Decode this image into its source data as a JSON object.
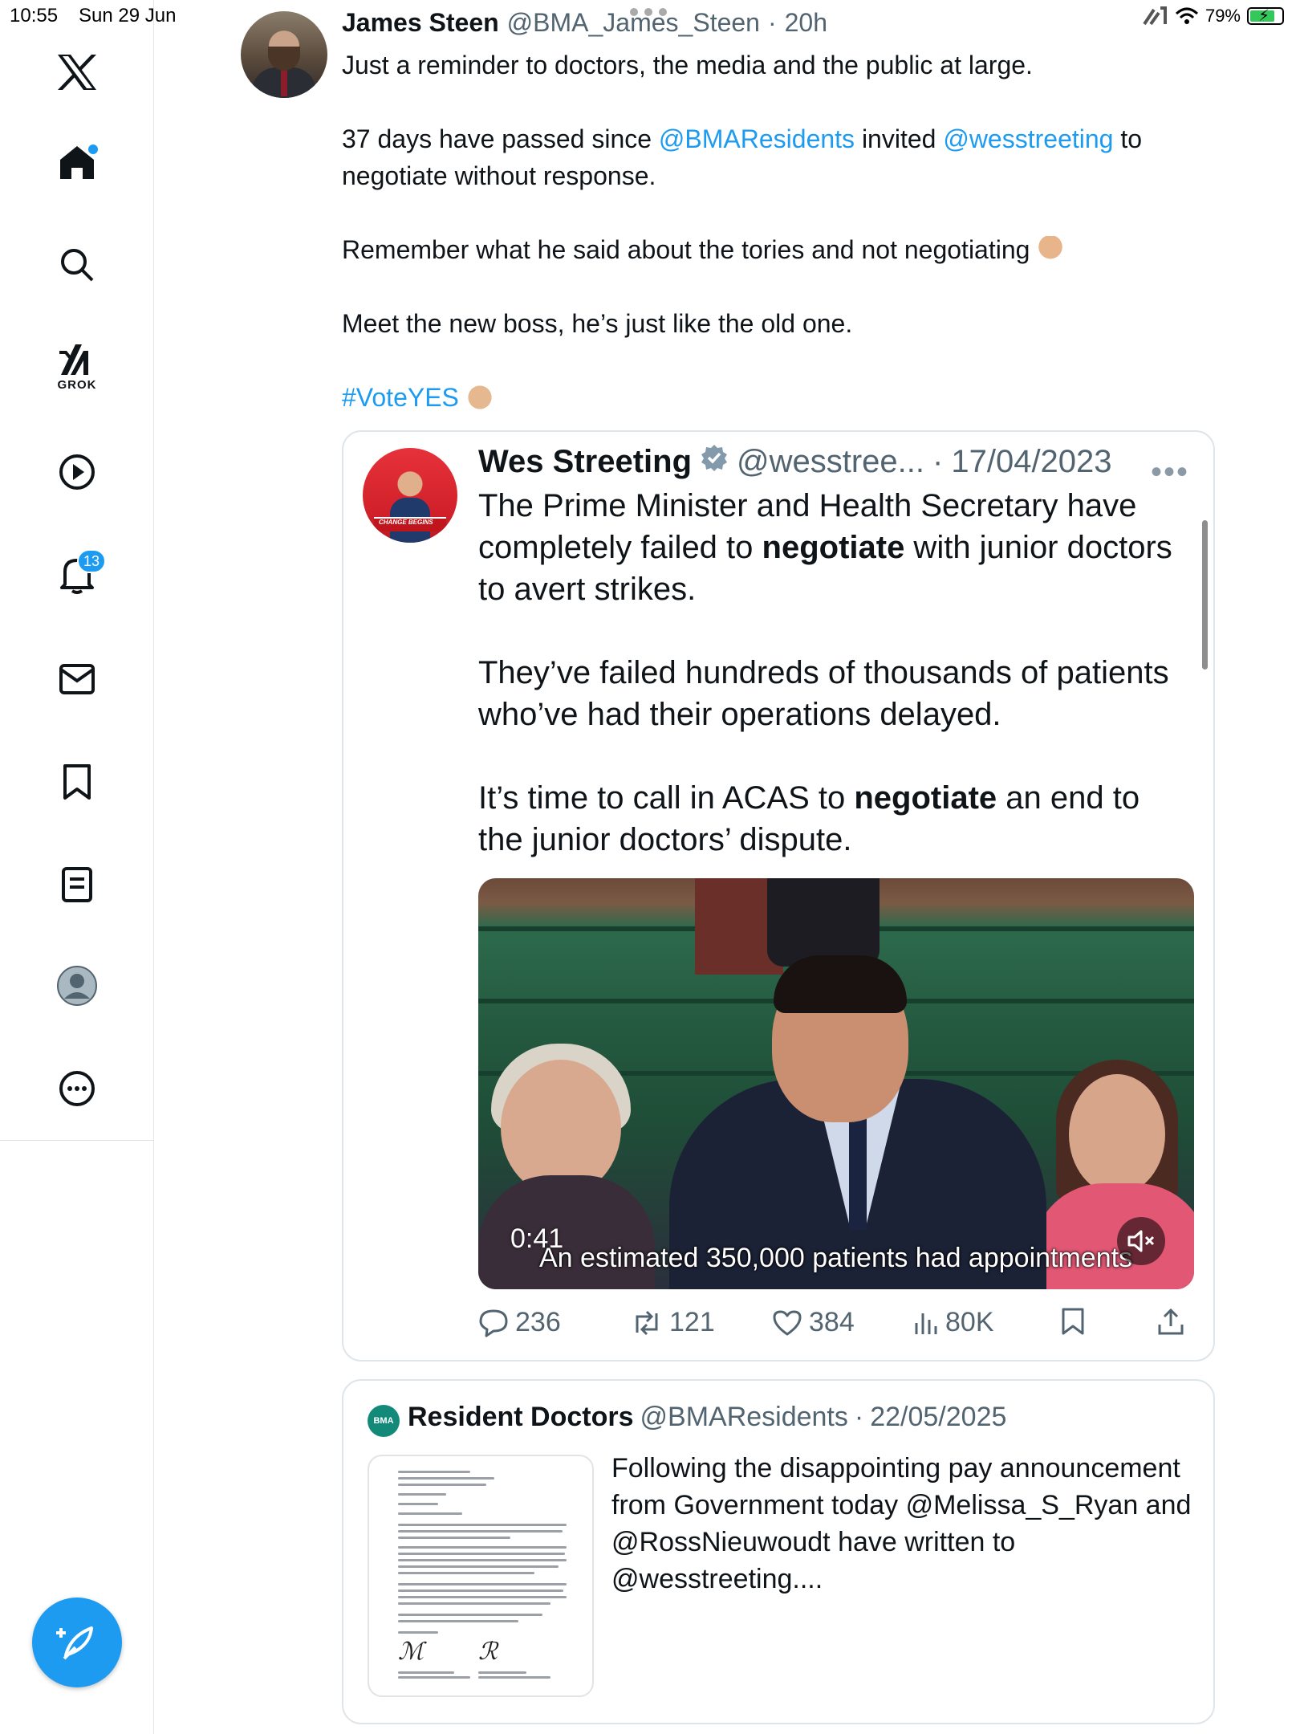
{
  "status_bar": {
    "time": "10:55",
    "date": "Sun 29 Jun",
    "battery": "79%"
  },
  "sidebar": {
    "grok_label": "GROK",
    "notification_count": "13",
    "items": [
      {
        "icon": "x-logo-icon"
      },
      {
        "icon": "home-icon"
      },
      {
        "icon": "search-icon"
      },
      {
        "icon": "grok-icon"
      },
      {
        "icon": "video-play-icon"
      },
      {
        "icon": "notifications-bell-icon"
      },
      {
        "icon": "messages-envelope-icon"
      },
      {
        "icon": "bookmarks-icon"
      },
      {
        "icon": "lists-icon"
      },
      {
        "icon": "profile-icon"
      },
      {
        "icon": "more-icon"
      }
    ]
  },
  "tweet": {
    "author_name": "James Steen",
    "author_handle": "@BMA_James_Steen",
    "time": "20h",
    "line1": "Just a reminder to doctors, the media and the public at large.",
    "line2_pre": "37 days have passed since ",
    "line2_link1": "@BMAResidents",
    "line2_mid": " invited ",
    "line2_link2": "@wesstreeting",
    "line2_post": " to negotiate without response.",
    "line3": "Remember what he said about the tories and not negotiating",
    "line4": "Meet the new boss, he’s just like the old one.",
    "hashtag": "#VoteYES"
  },
  "quoted_tweet": {
    "author_name": "Wes Streeting",
    "author_handle": "@wesstree...",
    "date": "17/04/2023",
    "avatar_text": "CHANGE BEGINS",
    "p1_a": "The Prime Minister and Health Secretary have completely failed to ",
    "p1_bold": "negotiate",
    "p1_b": " with junior doctors to avert strikes.",
    "p2": "They’ve failed hundreds of thousands of patients who’ve had their operations delayed.",
    "p3_a": "It’s time to call in ACAS to ",
    "p3_bold": "negotiate",
    "p3_b": " an end to the junior doctors’ dispute.",
    "video_time": "0:41",
    "video_caption": "An estimated 350,000 patients had appointments",
    "replies": "236",
    "reposts": "121",
    "likes": "384",
    "views": "80K"
  },
  "quoted_tweet_2": {
    "author_name": "Resident Doctors",
    "author_handle": "@BMAResidents",
    "date": "22/05/2025",
    "logo_text": "BMA",
    "text": "Following the disappointing pay announcement from Government today @Melissa_S_Ryan and @RossNieuwoudt have written to @wesstreeting...."
  },
  "colors": {
    "accent": "#1d9bf0",
    "text": "#0f1419",
    "muted": "#536471",
    "border": "#dfe5e9"
  }
}
